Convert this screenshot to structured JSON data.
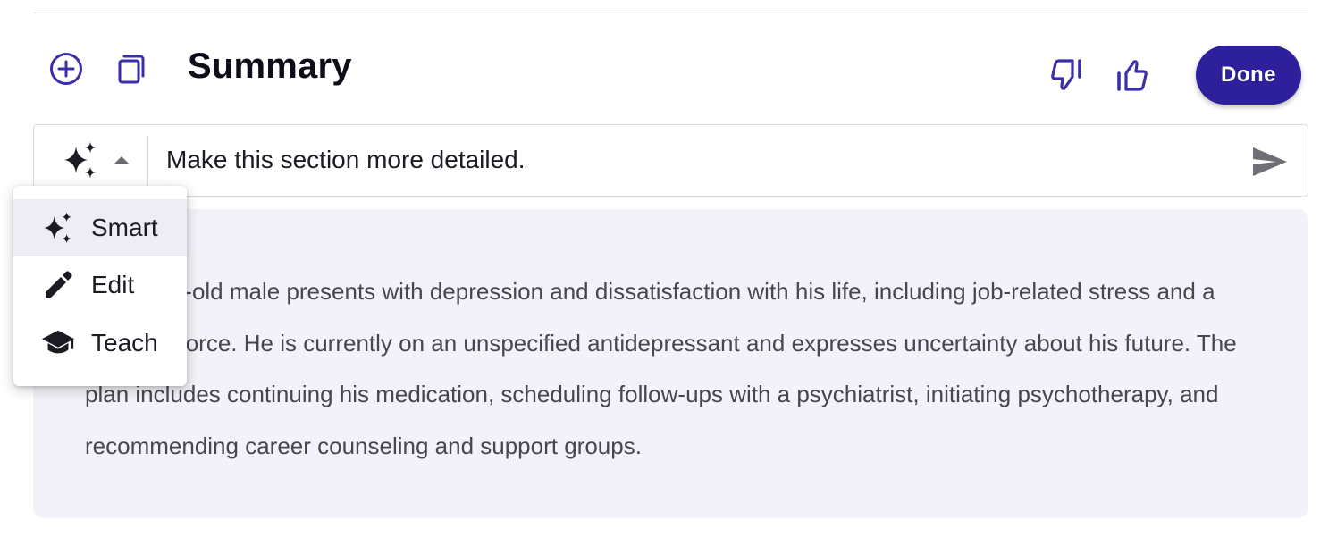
{
  "header": {
    "title": "Summary",
    "done_label": "Done"
  },
  "prompt": {
    "value": "Make this section more detailed.",
    "mode": "Smart"
  },
  "mode_menu": {
    "items": [
      {
        "label": "Smart",
        "icon": "sparkle-icon",
        "selected": true
      },
      {
        "label": "Edit",
        "icon": "pencil-icon",
        "selected": false
      },
      {
        "label": "Teach",
        "icon": "graduation-cap-icon",
        "selected": false
      }
    ]
  },
  "content": {
    "summary": "A 42-year-old male presents with depression and dissatisfaction with his life, including job-related stress and a recent divorce. He is currently on an unspecified antidepressant and expresses uncertainty about his future. The plan includes continuing his medication, scheduling follow-ups with a psychiatrist, initiating psychotherapy, and recommending career counseling and support groups."
  },
  "colors": {
    "accent": "#2e1f9b",
    "icon_accent": "#3a2fa8",
    "card_bg": "#f3f2f8",
    "text": "#464651"
  }
}
